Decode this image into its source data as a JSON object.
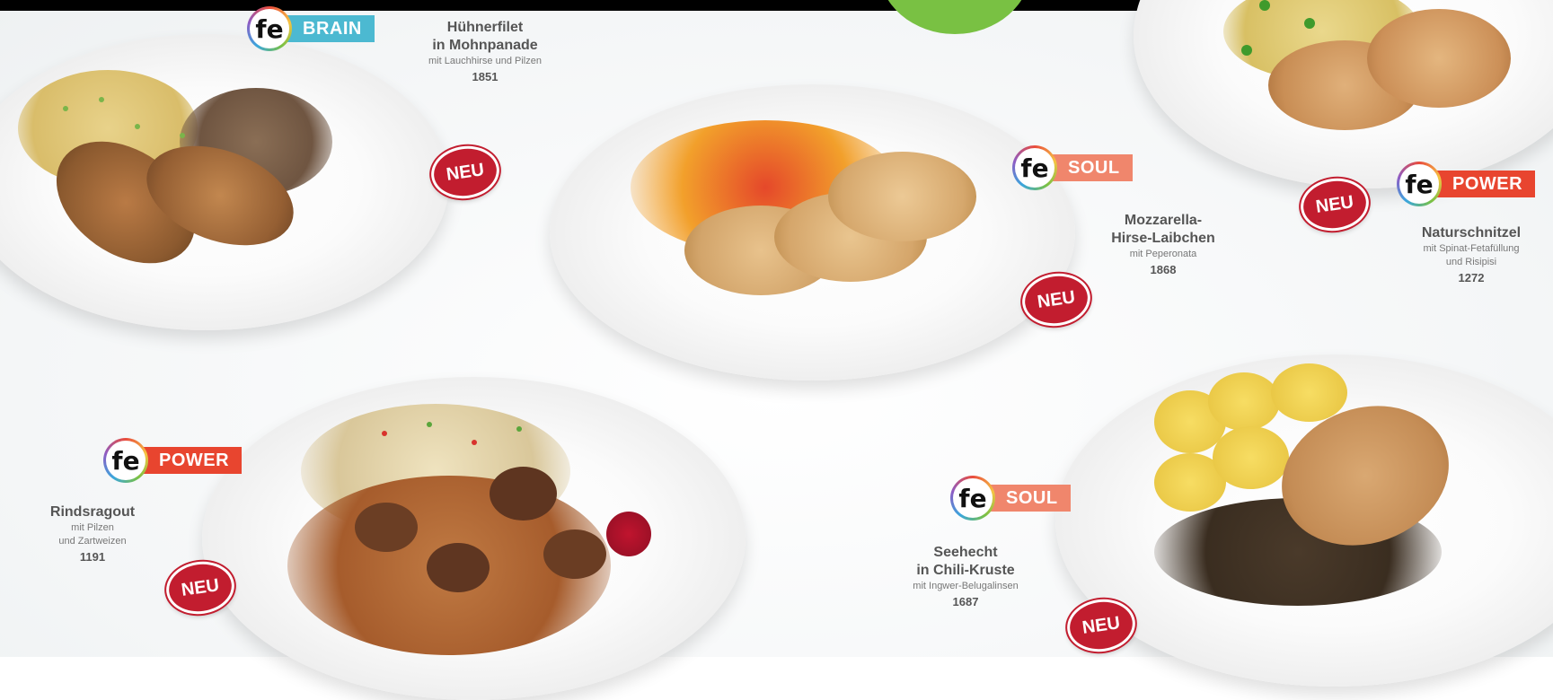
{
  "dishes": [
    {
      "category": "BRAIN",
      "name1": "Hühnerfilet",
      "name2": "in Mohnpanade",
      "sub1": "mit Lauchhirse und Pilzen",
      "sub2": "",
      "number": "1851",
      "new": "NEU"
    },
    {
      "category": "SOUL",
      "name1": "Mozzarella-",
      "name2": "Hirse-Laibchen",
      "sub1": "mit Peperonata",
      "sub2": "",
      "number": "1868",
      "new": "NEU"
    },
    {
      "category": "POWER",
      "name1": "Naturschnitzel",
      "name2": "",
      "sub1": "mit Spinat-Fetafüllung",
      "sub2": "und Risipisi",
      "number": "1272",
      "new": "NEU"
    },
    {
      "category": "POWER",
      "name1": "Rindsragout",
      "name2": "",
      "sub1": "mit Pilzen",
      "sub2": "und Zartweizen",
      "number": "1191",
      "new": "NEU"
    },
    {
      "category": "SOUL",
      "name1": "Seehecht",
      "name2": "in Chili-Kruste",
      "sub1": "mit Ingwer-Belugalinsen",
      "sub2": "",
      "number": "1687",
      "new": "NEU"
    }
  ],
  "logo_text": "fe",
  "colors": {
    "brain": "#4cb9d1",
    "soul": "#f0866c",
    "power": "#e8452f",
    "neu": "#c21d2f",
    "accent": "#79c143"
  }
}
